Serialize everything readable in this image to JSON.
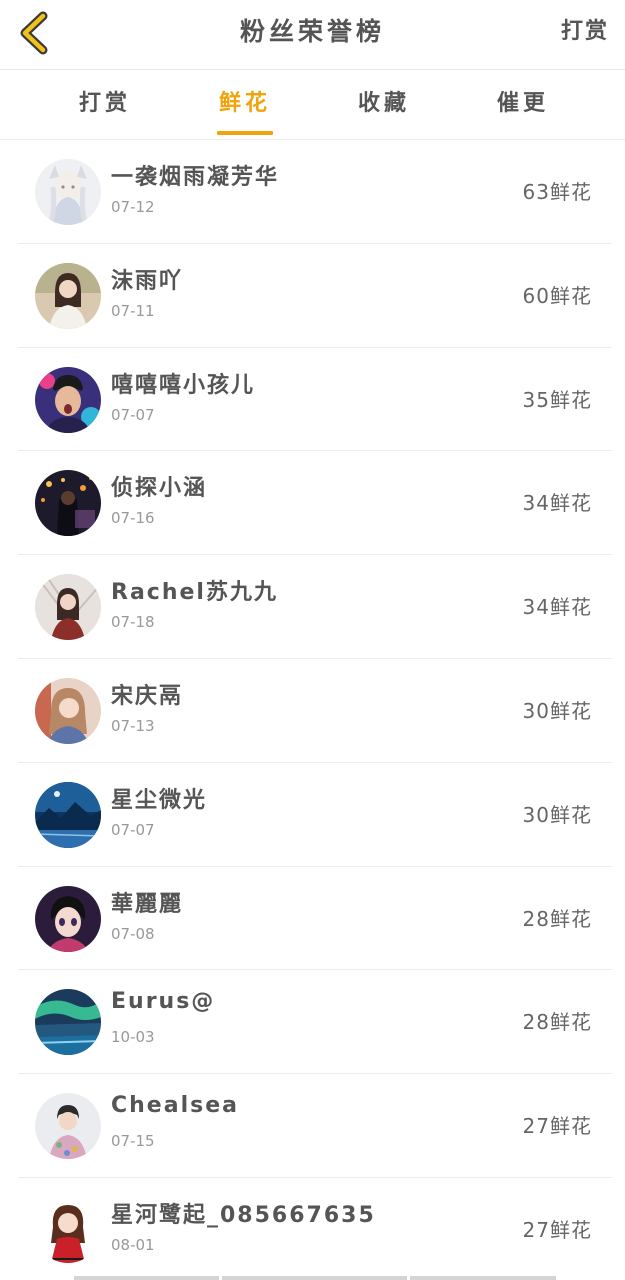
{
  "header": {
    "title": "粉丝荣誉榜",
    "action_label": "打赏"
  },
  "tabs": [
    {
      "label": "打赏",
      "active": false
    },
    {
      "label": "鲜花",
      "active": true
    },
    {
      "label": "收藏",
      "active": false
    },
    {
      "label": "催更",
      "active": false
    }
  ],
  "accent_color": "#f0a30a",
  "ranking": [
    {
      "name": "一袭烟雨凝芳华",
      "date": "07-12",
      "count": "63鲜花",
      "avatar": "anime-girl-avatar"
    },
    {
      "name": "沫雨吖",
      "date": "07-11",
      "count": "60鲜花",
      "avatar": "girl-photo-avatar"
    },
    {
      "name": "嘻嘻嘻小孩儿",
      "date": "07-07",
      "count": "35鲜花",
      "avatar": "boy-photo-avatar"
    },
    {
      "name": "侦探小涵",
      "date": "07-16",
      "count": "34鲜花",
      "avatar": "night-scene-avatar"
    },
    {
      "name": "Rachel苏九九",
      "date": "07-18",
      "count": "34鲜花",
      "avatar": "girl-photo-avatar"
    },
    {
      "name": "宋庆鬲",
      "date": "07-13",
      "count": "30鲜花",
      "avatar": "girl-photo-avatar"
    },
    {
      "name": "星尘微光",
      "date": "07-07",
      "count": "30鲜花",
      "avatar": "mountain-night-avatar"
    },
    {
      "name": "華麗麗",
      "date": "07-08",
      "count": "28鲜花",
      "avatar": "anime-boy-avatar"
    },
    {
      "name": "Eurus@",
      "date": "10-03",
      "count": "28鲜花",
      "avatar": "aurora-avatar"
    },
    {
      "name": "Chealsea",
      "date": "07-15",
      "count": "27鲜花",
      "avatar": "boy-photo-avatar"
    },
    {
      "name": "星河鹭起_085667635",
      "date": "08-01",
      "count": "27鲜花",
      "avatar": "cartoon-girl-avatar"
    }
  ]
}
